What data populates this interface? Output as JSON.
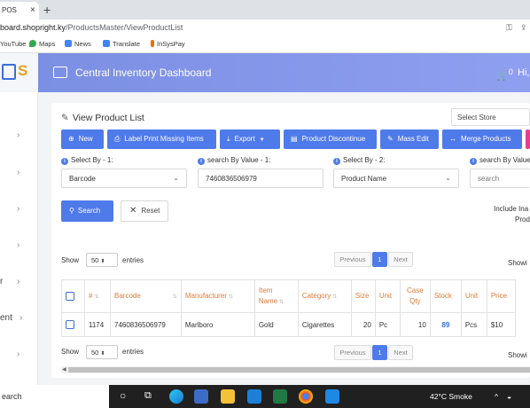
{
  "browser": {
    "tab_title": "POS",
    "tab_close": "×",
    "new_tab": "+",
    "url_host": "board.shopright.ky",
    "url_path": "/ProductsMaster/ViewProductList",
    "bookmarks": [
      "YouTube",
      "Maps",
      "News",
      "Translate",
      "InSysPay"
    ]
  },
  "sidebar": {
    "logo_letter": "S",
    "items": [
      {
        "label": "",
        "chevron": "›"
      },
      {
        "label": "",
        "chevron": "›"
      },
      {
        "label": "",
        "chevron": "›"
      },
      {
        "label": "",
        "chevron": "›"
      },
      {
        "label": "r",
        "chevron": "›"
      },
      {
        "label": "ent",
        "chevron": "›"
      },
      {
        "label": "",
        "chevron": "›"
      }
    ]
  },
  "header": {
    "title": "Central Inventory Dashboard",
    "cart_count": "0",
    "greeting": "Hi,"
  },
  "page": {
    "title": "View Product List",
    "store_select": "Select Store",
    "buttons": {
      "new": "New",
      "label_print": "Label Print Missing Items",
      "export": "Export",
      "discontinue": "Product Discontinue",
      "mass_edit": "Mass Edit",
      "merge": "Merge Products"
    },
    "filters": {
      "select_by_1_label": "Select By - 1:",
      "select_by_1_value": "Barcode",
      "search_value_1_label": "search By Value - 1:",
      "search_value_1_value": "7460836506979",
      "select_by_2_label": "Select By - 2:",
      "select_by_2_value": "Product Name",
      "search_value_2_label": "search By Value",
      "search_value_2_placeholder": "search"
    },
    "search_label": "Search",
    "reset_label": "Reset",
    "include_label": "Include Ina",
    "include_label2": "Prod",
    "show_label": "Show",
    "entries_label": "entries",
    "entries_value": "50",
    "previous": "Previous",
    "next": "Next",
    "page_num": "1",
    "showing": "Showi"
  },
  "table": {
    "headers": [
      "#",
      "Barcode",
      "Manufacturer",
      "Item Name",
      "Category",
      "Size",
      "Unit",
      "Case Qty",
      "Stock",
      "Unit",
      "Price"
    ],
    "rows": [
      {
        "num": "1174",
        "barcode": "7460836506979",
        "manufacturer": "Marlboro",
        "item_name": "Gold",
        "category": "Cigarettes",
        "size": "20",
        "unit": "Pc",
        "case_qty": "10",
        "stock": "89",
        "unit2": "Pcs",
        "price": "$10"
      }
    ]
  },
  "taskbar": {
    "search": "earch",
    "weather": "42°C  Smoke"
  }
}
